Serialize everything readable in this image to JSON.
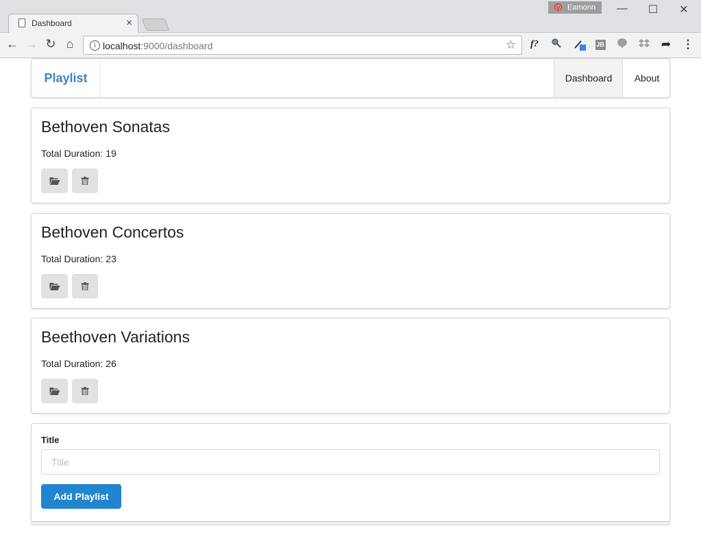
{
  "browser": {
    "tab_title": "Dashboard",
    "tab_close": "×",
    "profile_name": "Eamonn",
    "url_host": "localhost",
    "url_path": ":9000/dashboard",
    "window_controls": {
      "minimize": "—",
      "maximize": "☐",
      "close": "✕"
    },
    "extensions": [
      "f?",
      "search-icon",
      "eyedropper-icon",
      "JB",
      "chat-bubble-icon",
      "dropbox-icon",
      "share-arrow-icon",
      "menu-icon"
    ],
    "extension_text": {
      "formula": "f?",
      "jetbrains": "JB",
      "share": "➦",
      "menu": "⋮"
    }
  },
  "navbar": {
    "brand": "Playlist",
    "items": [
      {
        "label": "Dashboard",
        "active": true
      },
      {
        "label": "About",
        "active": false
      }
    ]
  },
  "playlists": [
    {
      "title": "Bethoven Sonatas",
      "duration_label": "Total Duration:",
      "duration": "19"
    },
    {
      "title": "Bethoven Concertos",
      "duration_label": "Total Duration:",
      "duration": "23"
    },
    {
      "title": "Beethoven Variations",
      "duration_label": "Total Duration:",
      "duration": "26"
    }
  ],
  "form": {
    "title_label": "Title",
    "title_placeholder": "Title",
    "title_value": "",
    "submit_label": "Add Playlist"
  },
  "colors": {
    "brand": "#4183c4",
    "primary_button": "#2185d0",
    "icon_button": "#e0e1e2"
  }
}
